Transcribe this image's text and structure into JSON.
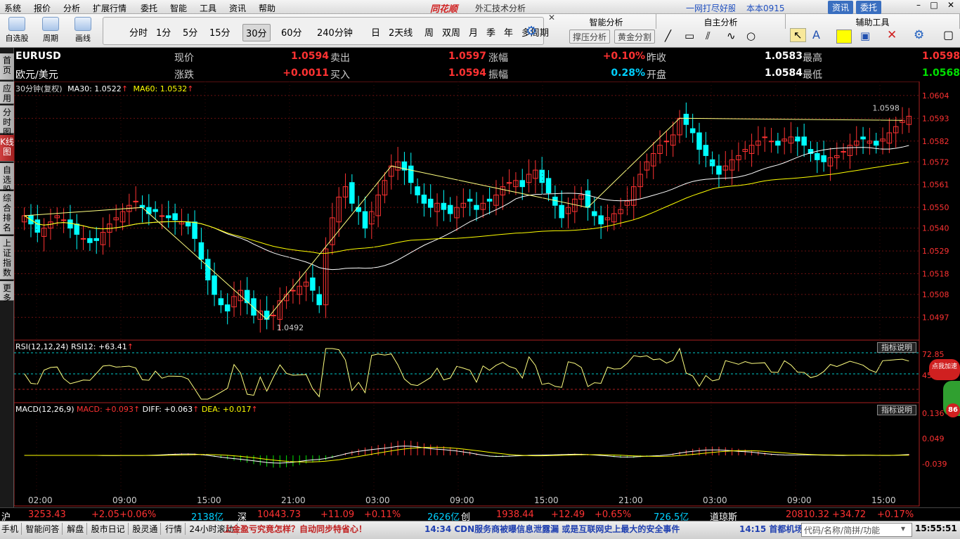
{
  "menu": [
    "系统",
    "报价",
    "分析",
    "扩展行情",
    "委托",
    "智能",
    "工具",
    "资讯",
    "帮助"
  ],
  "app": {
    "logo": "同花顺",
    "subtitle": "外汇技术分析",
    "ticker_scroll": "一网打尽好股",
    "user": "本本0915",
    "btn_info": "资讯",
    "btn_trade": "委托"
  },
  "toolbar": {
    "big": [
      {
        "label": "自选股",
        "icon": "star-icon"
      },
      {
        "label": "周期",
        "icon": "clock-icon"
      },
      {
        "label": "画线",
        "icon": "pen-icon"
      }
    ],
    "periods": [
      "分时",
      "1分",
      "5分",
      "15分",
      "30分",
      "60分",
      "240分钟",
      "日",
      "2天线",
      "周",
      "双周",
      "月",
      "季",
      "年",
      "多周期"
    ],
    "active_period": "30分"
  },
  "panels": {
    "smart": "智能分析",
    "self": "自主分析",
    "aux": "辅助工具",
    "btn1": "撑压分析",
    "btn2": "黄金分割"
  },
  "sidebar": [
    "首页",
    "应用",
    "分时图",
    "K线图",
    "自选股",
    "综合排名",
    "上证指数",
    "更多"
  ],
  "active_side": "K线图",
  "quote": {
    "code": "EURUSD",
    "name": "欧元/美元",
    "rows": [
      {
        "l1": "现价",
        "v1": "1.0594",
        "l2": "卖出",
        "v2": "1.0597",
        "l3": "涨幅",
        "v3": "+0.10%",
        "l4": "昨收",
        "v4": "1.0583",
        "l5": "最高",
        "v5": "1.0598"
      },
      {
        "l1": "涨跌",
        "v1": "+0.0011",
        "l2": "买入",
        "v2": "1.0594",
        "l3": "振幅",
        "v3": "0.28%",
        "l4": "开盘",
        "v4": "1.0584",
        "l5": "最低",
        "v5": "1.0568"
      }
    ]
  },
  "indicators": {
    "main": {
      "period": "30分钟(复权)",
      "ma30": "MA30: 1.0522",
      "ma60": "MA60: 1.0532"
    },
    "rsi": {
      "label": "RSI(12,12,24)",
      "value": "RSI12: +63.41"
    },
    "macd": {
      "label": "MACD(12,26,9)",
      "macd": "MACD: +0.093",
      "diff": "DIFF: +0.063",
      "dea": "DEA: +0.017"
    },
    "help": "指标说明"
  },
  "chart_data": {
    "type": "candlestick",
    "y_ticks": [
      "1.0604",
      "1.0593",
      "1.0582",
      "1.0572",
      "1.0561",
      "1.0550",
      "1.0540",
      "1.0529",
      "1.0518",
      "1.0508",
      "1.0497"
    ],
    "ylim": [
      1.0488,
      1.0606
    ],
    "high_label": "1.0598",
    "low_label": "1.0492",
    "x_ticks": [
      "02:00",
      "09:00",
      "15:00",
      "21:00",
      "03:00",
      "09:00",
      "15:00",
      "21:00",
      "03:00",
      "09:00",
      "15:00"
    ],
    "rsi_ticks": [
      "72.85",
      "45.57"
    ],
    "macd_ticks": [
      "0.136",
      "0.049",
      "-0.039"
    ],
    "closes": [
      1.0546,
      1.0542,
      1.0538,
      1.054,
      1.0543,
      1.0546,
      1.0544,
      1.054,
      1.0537,
      1.0535,
      1.0533,
      1.0534,
      1.0538,
      1.0542,
      1.0545,
      1.0548,
      1.0551,
      1.0553,
      1.055,
      1.0547,
      1.0548,
      1.0546,
      1.0545,
      1.0544,
      1.0543,
      1.0541,
      1.0535,
      1.0525,
      1.0515,
      1.0508,
      1.0503,
      1.05,
      1.0507,
      1.051,
      1.0504,
      1.0498,
      1.05,
      1.0496,
      1.0498,
      1.0505,
      1.0508,
      1.051,
      1.0512,
      1.0514,
      1.051,
      1.0503,
      1.053,
      1.0545,
      1.0555,
      1.056,
      1.0552,
      1.0548,
      1.054,
      1.0548,
      1.0556,
      1.0563,
      1.057,
      1.0572,
      1.0568,
      1.0562,
      1.0556,
      1.0552,
      1.055,
      1.0552,
      1.0549,
      1.0547,
      1.055,
      1.0552,
      1.0553,
      1.0549,
      1.0552,
      1.0553,
      1.0556,
      1.056,
      1.0562,
      1.0563,
      1.056,
      1.0566,
      1.0568,
      1.0562,
      1.0557,
      1.0551,
      1.0545,
      1.055,
      1.0554,
      1.0556,
      1.055,
      1.0546,
      1.0542,
      1.0545,
      1.0547,
      1.0549,
      1.0553,
      1.056,
      1.0566,
      1.0572,
      1.0576,
      1.058,
      1.0582,
      1.0585,
      1.0593,
      1.059,
      1.0586,
      1.0578,
      1.0575,
      1.057,
      1.0566,
      1.057,
      1.0573,
      1.0575,
      1.0578,
      1.058,
      1.0582,
      1.0584,
      1.0582,
      1.058,
      1.0583,
      1.0584,
      1.0582,
      1.058,
      1.0576,
      1.0573,
      1.0572,
      1.0574,
      1.0575,
      1.0577,
      1.058,
      1.0582,
      1.0583,
      1.0582,
      1.058,
      1.0583,
      1.0586,
      1.0589,
      1.0592,
      1.0594
    ]
  },
  "status": {
    "items": [
      {
        "name": "沪",
        "v1": "3253.43",
        "v2": "+2.05",
        "v3": "+0.06%",
        "v4": "2138亿"
      },
      {
        "name": "深",
        "v1": "10443.73",
        "v2": "+11.09",
        "v3": "+0.11%",
        "v4": "2626亿"
      },
      {
        "name": "创",
        "v1": "1938.44",
        "v2": "+12.49",
        "v3": "+0.65%",
        "v4": "726.5亿"
      },
      {
        "name": "道琼斯",
        "v1": "20810.32",
        "v2": "+34.72",
        "v3": "+0.17%",
        "v4": ""
      }
    ]
  },
  "bottom": {
    "tabs": [
      "手机",
      "智能问答",
      "解盘",
      "股市日记",
      "股灵通",
      "行情",
      "24小时滚动"
    ],
    "news1": "上金盈亏究竟怎样？自动同步特省心！",
    "news2": "14:34 CDN服务商被曝信息泄露漏 或是互联网史上最大的安全事件",
    "news3": "14:15 首都机场",
    "search": "代码/名称/简拼/功能",
    "time": "15:55:51"
  },
  "colors": {
    "up": "#ff3232",
    "down": "#00ffff",
    "ma30": "#ffffff",
    "ma60": "#ffff00"
  }
}
